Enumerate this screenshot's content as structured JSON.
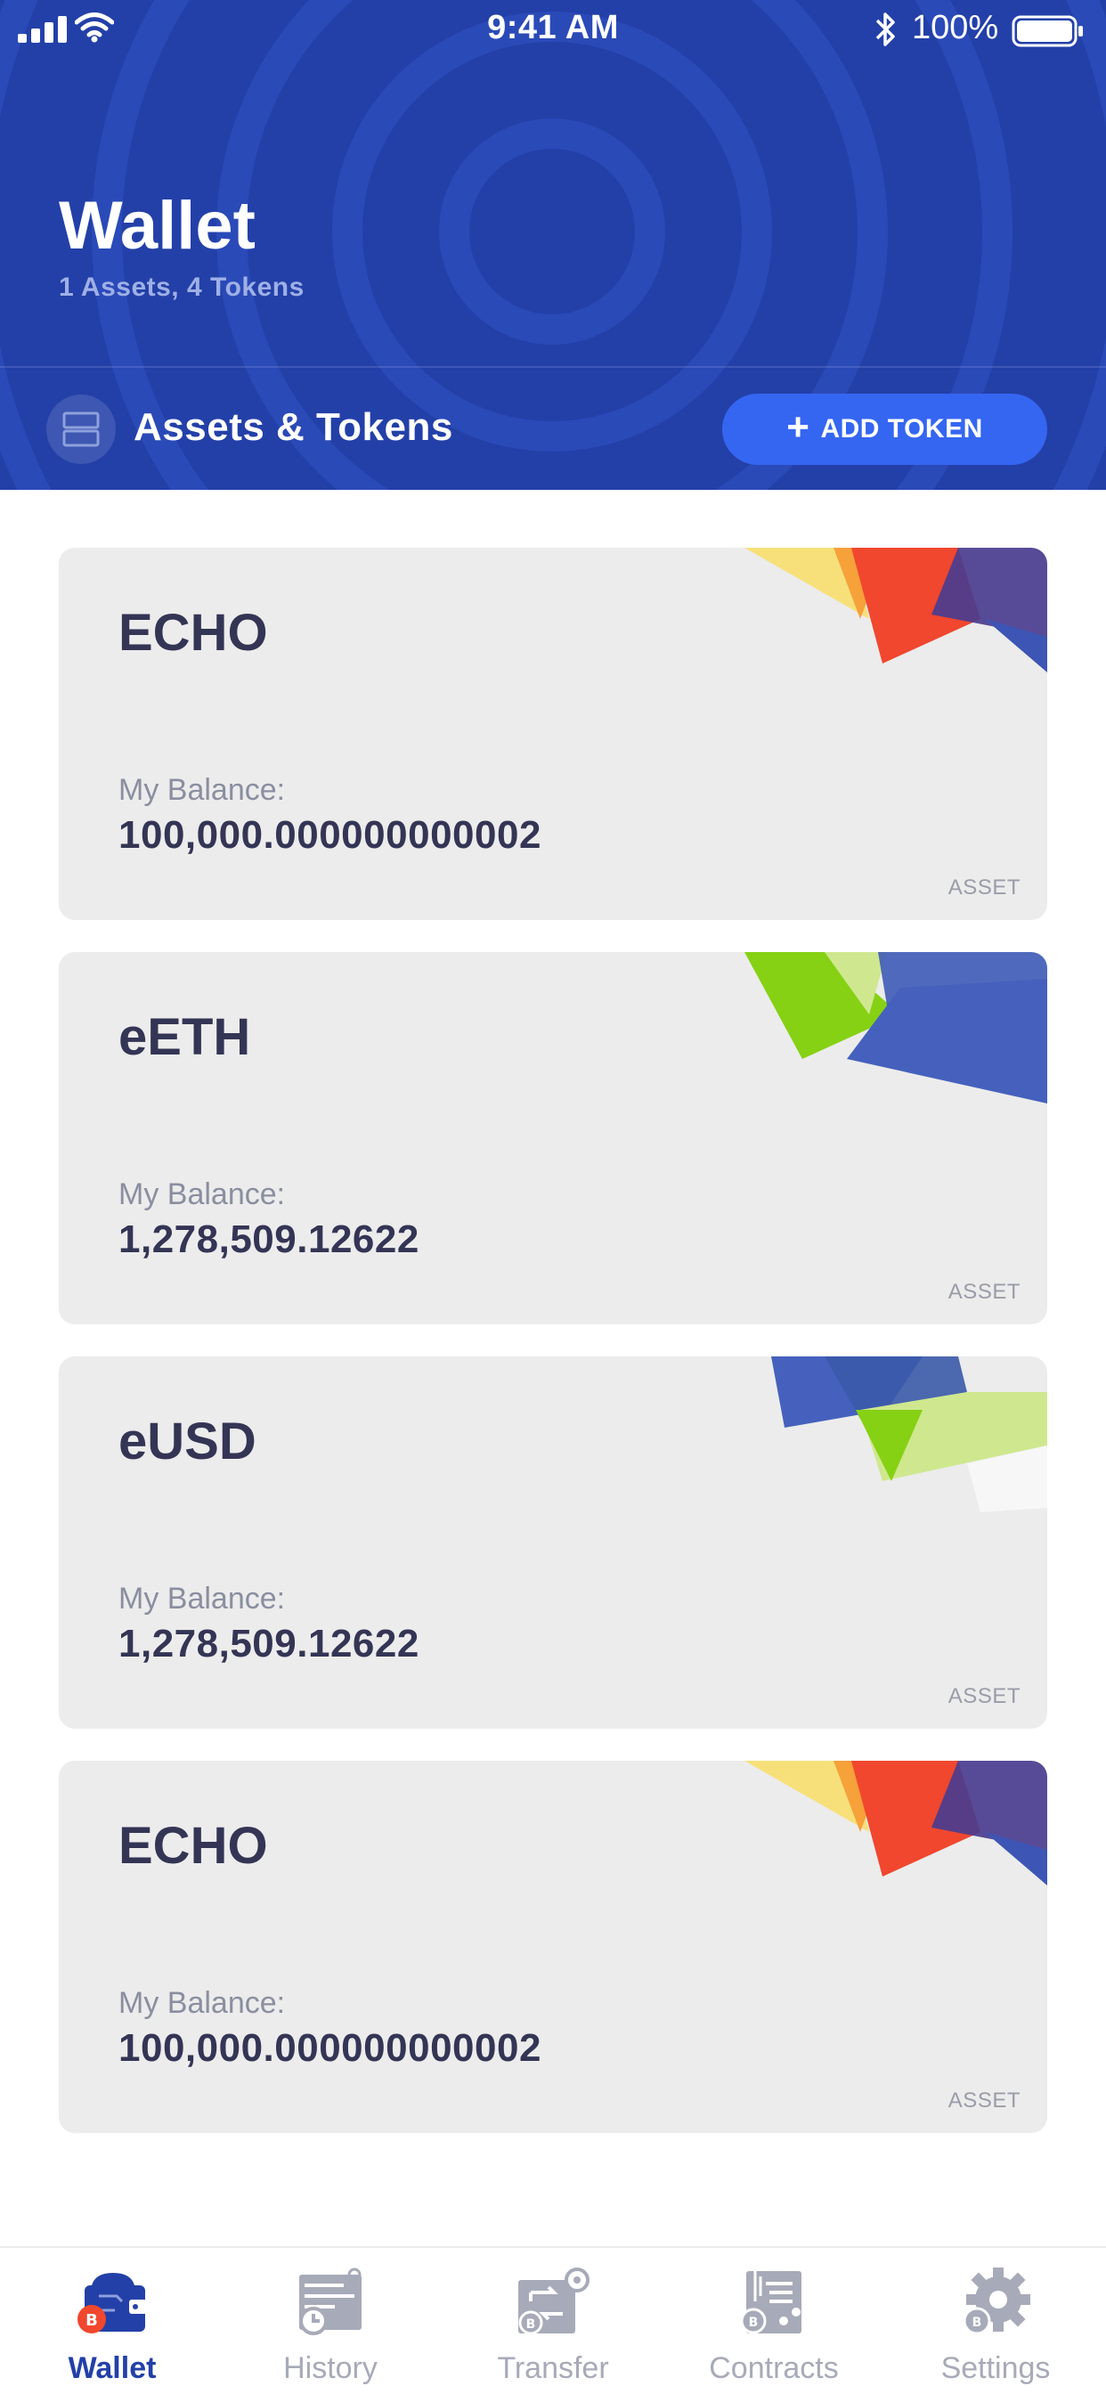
{
  "status_bar": {
    "time": "9:41 AM",
    "battery": "100%",
    "icons": [
      "cellular-signal-icon",
      "wifi-icon",
      "bluetooth-icon",
      "battery-icon"
    ]
  },
  "header": {
    "title": "Wallet",
    "subtitle": "1 Assets, 4 Tokens"
  },
  "section": {
    "title": "Assets & Tokens",
    "add_token_label": "ADD TOKEN",
    "icon": "stack-icon"
  },
  "cards": [
    {
      "name": "ECHO",
      "balance_label": "My Balance:",
      "balance": "100,000.000000000002",
      "type": "ASSET",
      "theme": "warm"
    },
    {
      "name": "eETH",
      "balance_label": "My Balance:",
      "balance": "1,278,509.12622",
      "type": "ASSET",
      "theme": "green-blue"
    },
    {
      "name": "eUSD",
      "balance_label": "My Balance:",
      "balance": "1,278,509.12622",
      "type": "ASSET",
      "theme": "blue-green"
    },
    {
      "name": "ECHO",
      "balance_label": "My Balance:",
      "balance": "100,000.000000000002",
      "type": "ASSET",
      "theme": "warm"
    }
  ],
  "tabs": [
    {
      "label": "Wallet",
      "icon": "wallet-icon",
      "active": true
    },
    {
      "label": "History",
      "icon": "history-icon",
      "active": false
    },
    {
      "label": "Transfer",
      "icon": "transfer-icon",
      "active": false
    },
    {
      "label": "Contracts",
      "icon": "contracts-icon",
      "active": false
    },
    {
      "label": "Settings",
      "icon": "settings-icon",
      "active": false
    }
  ],
  "colors": {
    "header_bg": "#2340a8",
    "button_bg": "#3566f2",
    "card_bg": "#ececec",
    "text_dark": "#343555",
    "active_tab": "#2340a8",
    "inactive_tab": "#a7aab8"
  }
}
